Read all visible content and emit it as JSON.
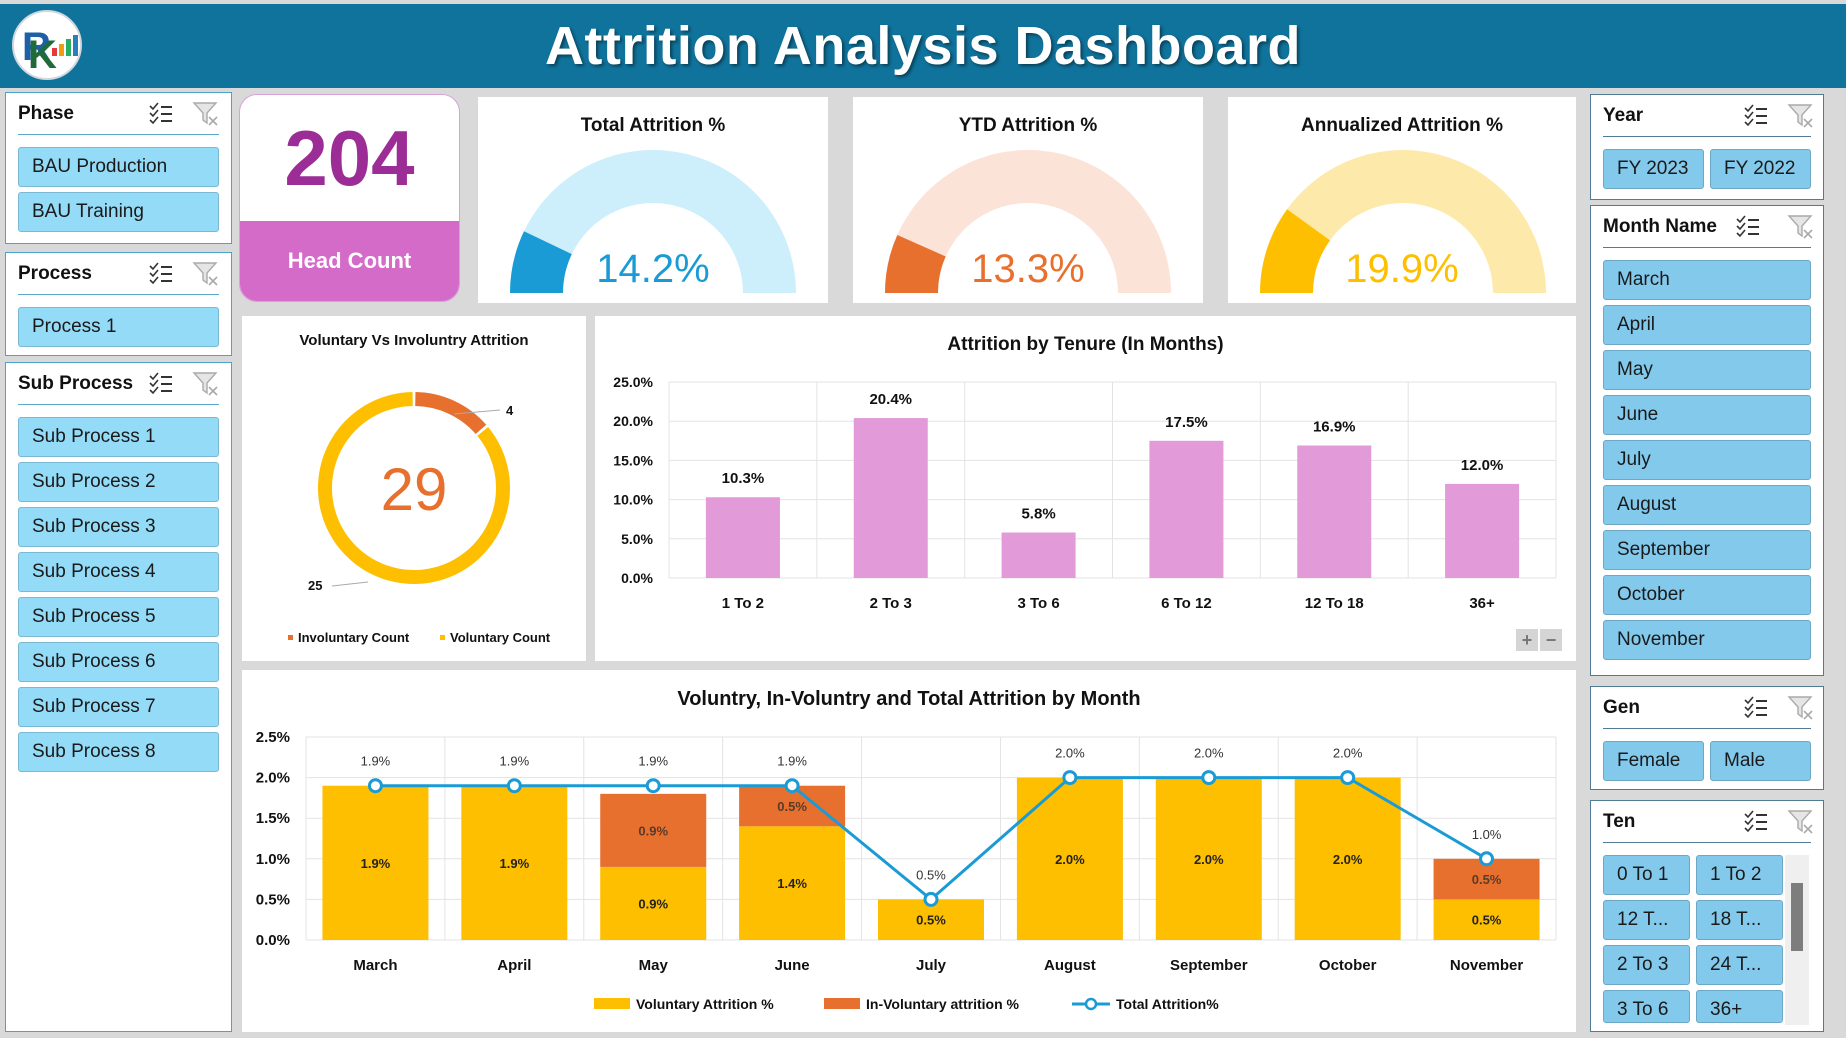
{
  "header": {
    "title": "Attrition Analysis Dashboard",
    "logo": "rk-logo"
  },
  "slicers": {
    "phase": {
      "title": "Phase",
      "items": [
        "BAU Production",
        "BAU Training"
      ]
    },
    "process": {
      "title": "Process",
      "items": [
        "Process 1"
      ]
    },
    "sub_process": {
      "title": "Sub Process",
      "items": [
        "Sub Process 1",
        "Sub Process 2",
        "Sub Process 3",
        "Sub Process 4",
        "Sub Process 5",
        "Sub Process 6",
        "Sub Process 7",
        "Sub Process 8"
      ]
    },
    "year": {
      "title": "Year",
      "items": [
        "FY 2023",
        "FY 2022"
      ]
    },
    "month": {
      "title": "Month Name",
      "items": [
        "March",
        "April",
        "May",
        "June",
        "July",
        "August",
        "September",
        "October",
        "November"
      ]
    },
    "gen": {
      "title": "Gen",
      "items": [
        "Female",
        "Male"
      ]
    },
    "ten": {
      "title": "Ten",
      "items": [
        "0 To 1",
        "1 To 2",
        "12 T...",
        "18 T...",
        "2 To 3",
        "24 T...",
        "3 To 6",
        "36+"
      ]
    },
    "icons": {
      "multi_select": "multi-select-icon",
      "clear_filter": "clear-filter-icon"
    }
  },
  "kpis": {
    "head_count": {
      "value": "204",
      "label": "Head Count"
    },
    "gauges": [
      {
        "title": "Total Attrition %",
        "value_label": "14.2%",
        "value": 14.2,
        "color": "#1a9bd6",
        "track": "#cdeefb"
      },
      {
        "title": "YTD Attrition %",
        "value_label": "13.3%",
        "value": 13.3,
        "color": "#e8702e",
        "track": "#fbe3d7"
      },
      {
        "title": "Annualized Attrition %",
        "value_label": "19.9%",
        "value": 19.9,
        "color": "#fdbf00",
        "track": "#fde9a9"
      }
    ]
  },
  "colors": {
    "voluntary": "#fdbf00",
    "involuntary": "#e8702e",
    "total_line": "#1a9bd6",
    "tenure_bar": "#e29ad9"
  },
  "chart_data": [
    {
      "type": "pie",
      "title": "Voluntary Vs Involuntry Attrition",
      "center_label": "29",
      "categories": [
        "Involuntary Count",
        "Voluntary Count"
      ],
      "values": [
        4,
        25
      ],
      "data_labels": [
        "4",
        "25"
      ],
      "legend": "bottom"
    },
    {
      "type": "bar",
      "title": "Attrition by Tenure (In Months)",
      "categories": [
        "1 To 2",
        "2 To 3",
        "3 To 6",
        "6 To 12",
        "12 To 18",
        "36+"
      ],
      "values": [
        10.3,
        20.4,
        5.8,
        17.5,
        16.9,
        12.0
      ],
      "data_labels": [
        "10.3%",
        "20.4%",
        "5.8%",
        "17.5%",
        "16.9%",
        "12.0%"
      ],
      "yticks": [
        "0.0%",
        "5.0%",
        "10.0%",
        "15.0%",
        "20.0%",
        "25.0%"
      ],
      "ylim": [
        0,
        25
      ],
      "grid": true,
      "xlabel": "",
      "ylabel": ""
    },
    {
      "type": "bar",
      "stacked": true,
      "title": "Voluntry, In-Voluntry and Total Attrition by Month",
      "categories": [
        "March",
        "April",
        "May",
        "June",
        "July",
        "August",
        "September",
        "October",
        "November"
      ],
      "series": [
        {
          "name": "Voluntary Attrition %",
          "type": "bar",
          "values": [
            1.9,
            1.9,
            0.9,
            1.4,
            0.5,
            2.0,
            2.0,
            2.0,
            0.5
          ],
          "labels": [
            "1.9%",
            "1.9%",
            "0.9%",
            "1.4%",
            "0.5%",
            "2.0%",
            "2.0%",
            "2.0%",
            "0.5%"
          ]
        },
        {
          "name": "In-Voluntary attrition %",
          "type": "bar",
          "values": [
            0,
            0,
            0.9,
            0.5,
            0,
            0,
            0,
            0,
            0.5
          ],
          "labels": [
            "",
            "",
            "0.9%",
            "0.5%",
            "",
            "",
            "",
            "",
            "0.5%"
          ]
        },
        {
          "name": "Total Attrition%",
          "type": "line",
          "values": [
            1.9,
            1.9,
            1.9,
            1.9,
            0.5,
            2.0,
            2.0,
            2.0,
            1.0
          ],
          "labels": [
            "1.9%",
            "1.9%",
            "1.9%",
            "1.9%",
            "0.5%",
            "2.0%",
            "2.0%",
            "2.0%",
            "1.0%"
          ]
        }
      ],
      "yticks": [
        "0.0%",
        "0.5%",
        "1.0%",
        "1.5%",
        "2.0%",
        "2.5%"
      ],
      "ylim": [
        0,
        2.5
      ],
      "grid": true,
      "legend": "bottom"
    }
  ]
}
